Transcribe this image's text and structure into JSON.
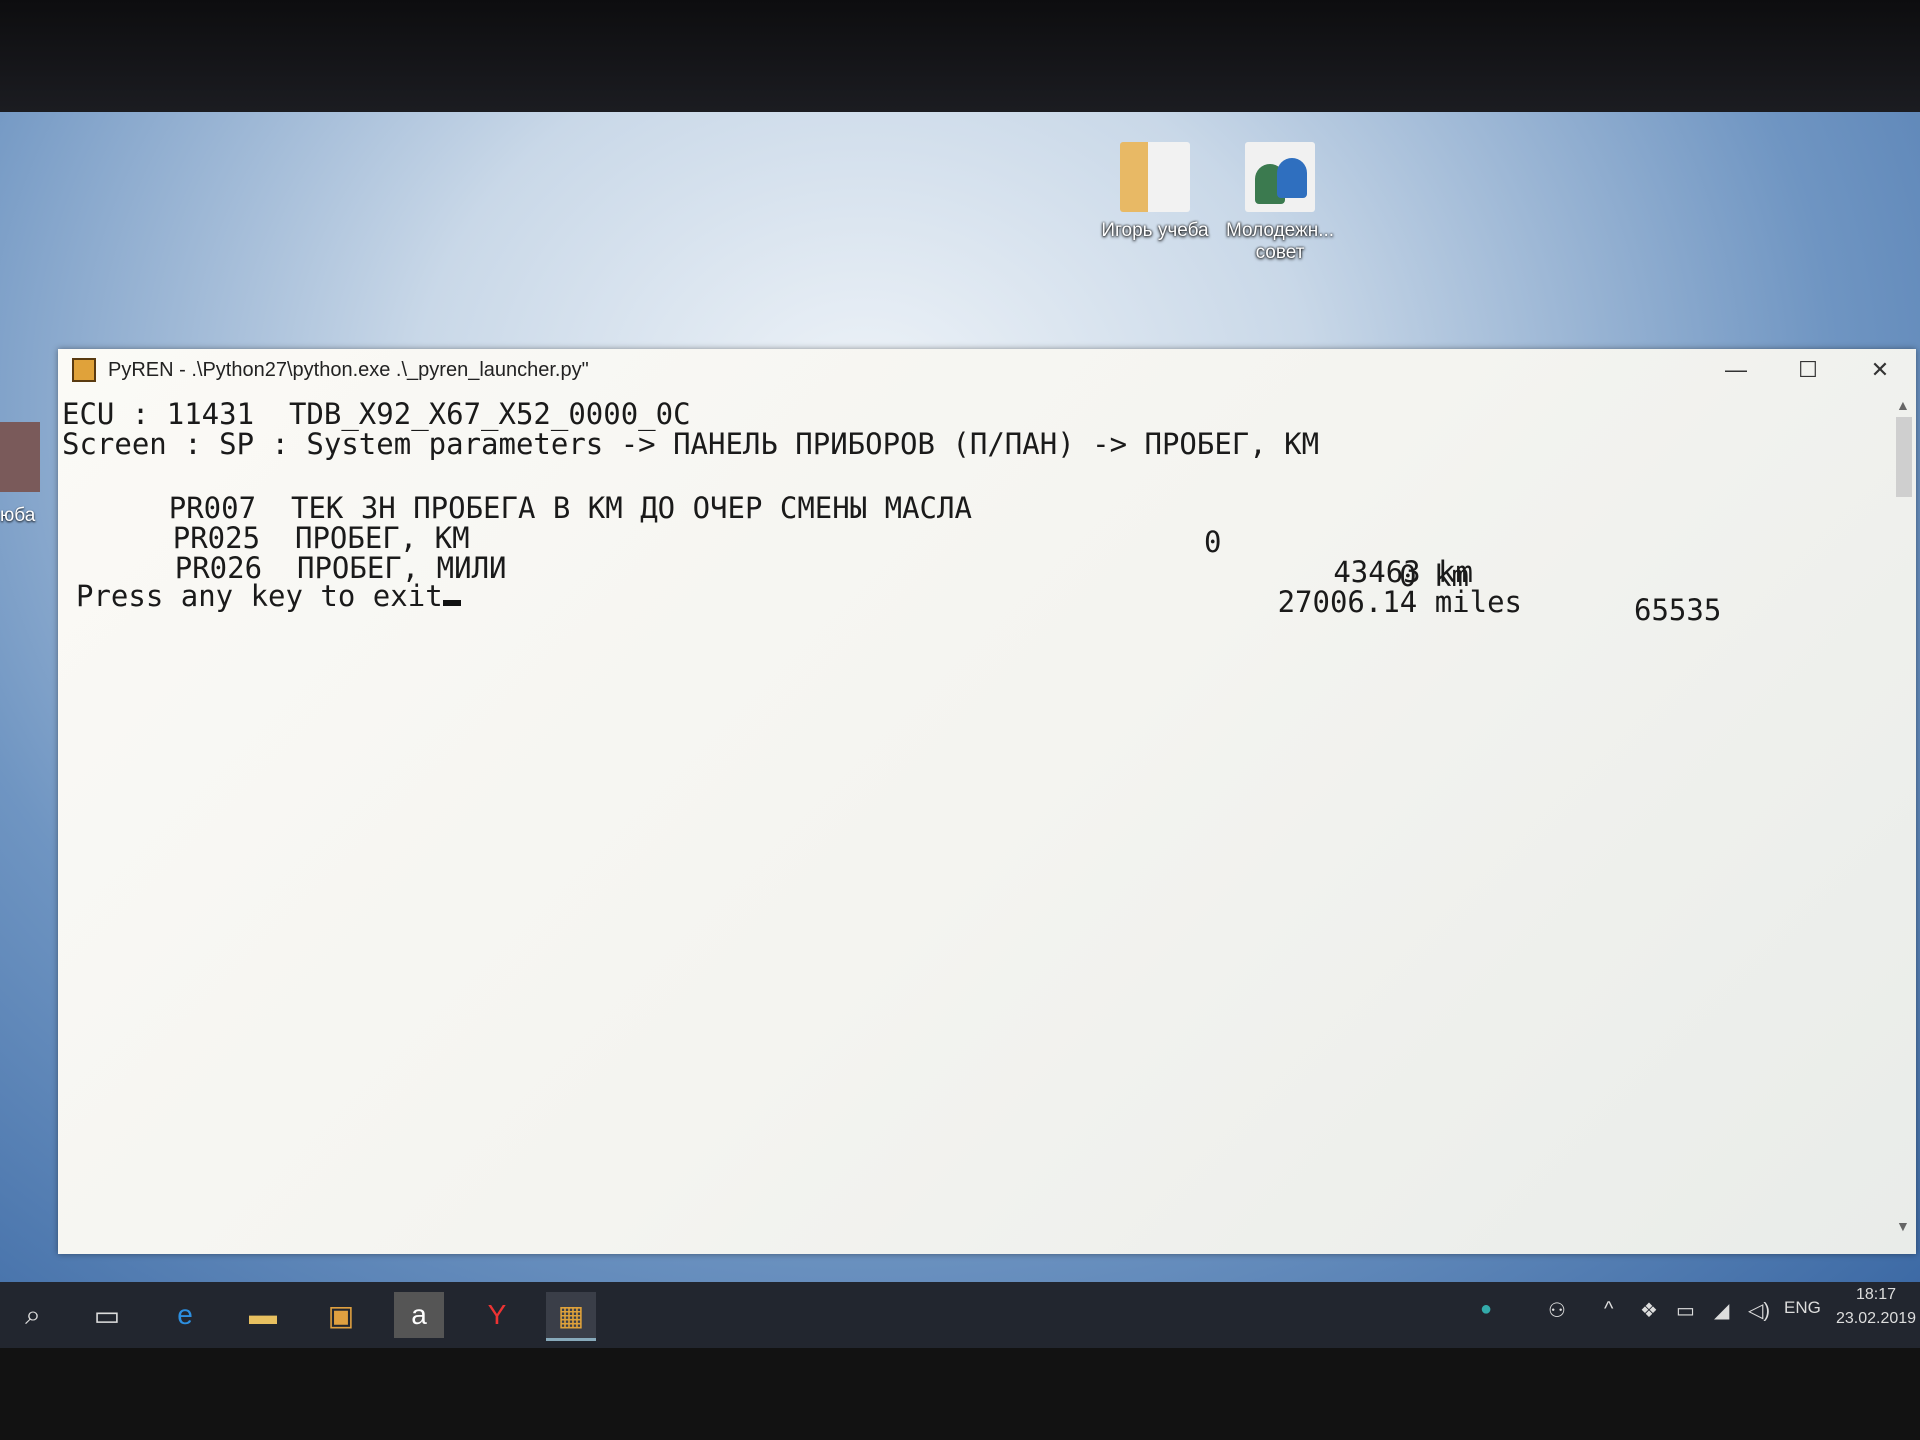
{
  "desktop": {
    "icons": [
      {
        "label": "Игорь учеба",
        "icon": "folder-icon"
      },
      {
        "label": "Молодежн...",
        "label2": "совет",
        "icon": "user-group-icon"
      }
    ],
    "left_partial_label": "юба"
  },
  "window": {
    "title": "PyREN - .\\Python27\\python.exe .\\_pyren_launcher.py\"",
    "minimize": "—",
    "maximize": "☐",
    "close": "✕"
  },
  "console": {
    "ecu_line": "ECU : 11431  TDB_X92_X67_X52_0000_0C",
    "screen_line": "Screen : SP : System parameters -> ПАНЕЛЬ ПРИБОРОВ (П/ПАН) -> ПРОБЕГ, КМ",
    "params": [
      {
        "id": "PR007",
        "name": "ТЕК ЗН ПРОБЕГА В КМ ДО ОЧЕР СМЕНЫ МАСЛА",
        "min": "0",
        "value": "0 km",
        "max": "65535"
      },
      {
        "id": "PR025",
        "name": "ПРОБЕГ, КМ",
        "value": "43463 km"
      },
      {
        "id": "PR026",
        "name": "ПРОБЕГ, МИЛИ",
        "value": "27006.14 miles"
      }
    ],
    "prompt": "Press any key to exit"
  },
  "taskbar": {
    "apps": [
      "search-icon",
      "task-view-icon",
      "edge-icon",
      "file-explorer-icon",
      "store-icon",
      "amazon-icon",
      "yandex-browser-icon",
      "pyren-icon"
    ],
    "language": "ENG",
    "time": "18:17",
    "date": "23.02.2019"
  }
}
